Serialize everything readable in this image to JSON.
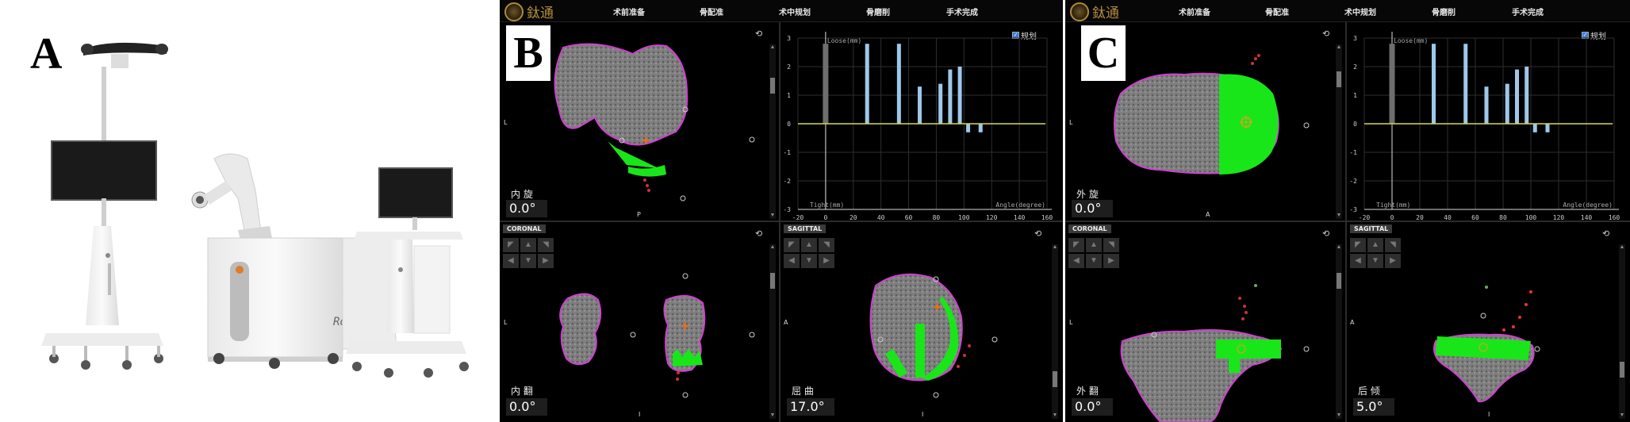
{
  "panels": {
    "a": "A",
    "b": "B",
    "c": "C"
  },
  "app": {
    "brand": "鈦通"
  },
  "menu": [
    "术前准备",
    "骨配准",
    "术中规划",
    "骨磨削",
    "手术完成"
  ],
  "labels": {
    "L": "L",
    "P": "P",
    "A": "A",
    "I": "I",
    "coronal": "CORONAL",
    "sagittal": "SAGITTAL",
    "plan": "规划"
  },
  "panelB": {
    "axial": {
      "label": "内 旋",
      "value": "0.0°"
    },
    "coronal": {
      "label": "内 翻",
      "value": "0.0°"
    },
    "sagittal": {
      "label": "屈 曲",
      "value": "17.0°"
    }
  },
  "panelC": {
    "axial": {
      "label": "外 旋",
      "value": "0.0°"
    },
    "coronal": {
      "label": "外 翻",
      "value": "0.0°"
    },
    "sagittal": {
      "label": "后 倾",
      "value": "5.0°"
    }
  },
  "chart_data": {
    "type": "bar",
    "ylabel_top": "Loose(mm)",
    "ylabel_bottom": "Tight(mm)",
    "xlabel": "Angle(degree)",
    "xlim": [
      -20,
      160
    ],
    "ylim": [
      -3,
      3
    ],
    "xticks": [
      -20,
      0,
      20,
      40,
      60,
      80,
      100,
      120,
      140,
      160
    ],
    "yticks": [
      3,
      2,
      1,
      0,
      -1,
      -2,
      -3
    ],
    "bars": [
      {
        "x": 0,
        "value": 2.8,
        "color": "#6e6e6e"
      },
      {
        "x": 30,
        "value": 2.8,
        "color": "#9fc7ea"
      },
      {
        "x": 53,
        "value": 2.8,
        "color": "#9fc7ea"
      },
      {
        "x": 68,
        "value": 1.3,
        "color": "#9fc7ea"
      },
      {
        "x": 83,
        "value": 1.4,
        "color": "#9fc7ea"
      },
      {
        "x": 90,
        "value": 1.9,
        "color": "#9fc7ea"
      },
      {
        "x": 97,
        "value": 2.0,
        "color": "#9fc7ea"
      },
      {
        "x": 103,
        "value": -0.3,
        "color": "#9fc7ea"
      },
      {
        "x": 112,
        "value": -0.3,
        "color": "#9fc7ea"
      }
    ],
    "zero_line_color": "#d9d94a"
  }
}
